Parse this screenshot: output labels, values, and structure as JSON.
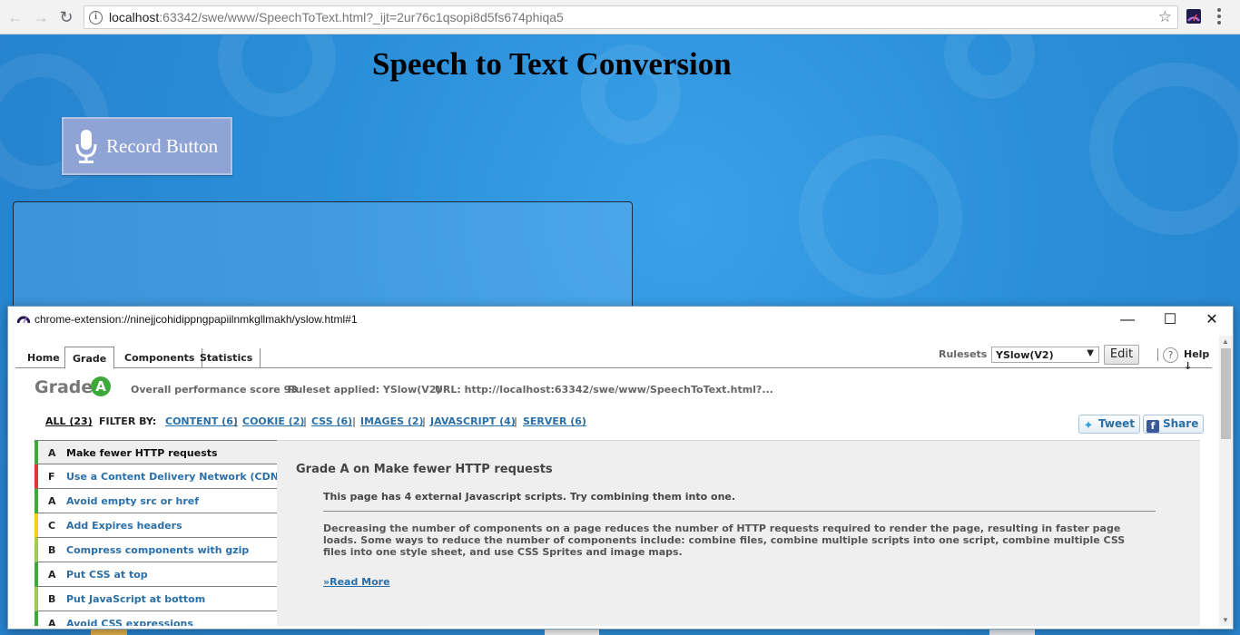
{
  "browser": {
    "url_host": "localhost",
    "url_rest": ":63342/swe/www/SpeechToText.html?_ijt=2ur76c1qsopi8d5fs674phiqa5"
  },
  "page": {
    "title": "Speech to Text Conversion",
    "record_button_label": "Record Button"
  },
  "popup": {
    "window_title": "chrome-extension://ninejjcohidippngpapiilnmkgllmakh/yslow.html#1",
    "controls": {
      "minimize": "—",
      "maximize": "☐",
      "close": "✕"
    }
  },
  "yslow": {
    "tabs": [
      {
        "label": "Home",
        "active": false
      },
      {
        "label": "Grade",
        "active": true
      },
      {
        "label": "Components",
        "active": false
      },
      {
        "label": "Statistics",
        "active": false
      }
    ],
    "rulesets_label": "Rulesets",
    "ruleset_selected": "YSlow(V2)",
    "edit_label": "Edit",
    "help_icon": "?",
    "help_label": "Help ↓",
    "grade_word": "Grade",
    "grade_letter": "A",
    "overall_score": "Overall performance score 93",
    "ruleset_applied": "Ruleset applied: YSlow(V2)",
    "url_info": "URL: http://localhost:63342/swe/www/SpeechToText.html?...",
    "filter": {
      "all": "ALL (23)",
      "label": "FILTER BY:",
      "items": [
        "CONTENT (6)",
        "COOKIE (2)",
        "CSS (6)",
        "IMAGES (2)",
        "JAVASCRIPT (4)",
        "SERVER (6)"
      ]
    },
    "tweet_label": "Tweet",
    "share_label": "Share",
    "rules": [
      {
        "grade": "A",
        "name": "Make fewer HTTP requests",
        "color": "#3da93a",
        "active": true
      },
      {
        "grade": "F",
        "name": "Use a Content Delivery Network (CDN)",
        "color": "#d9393a",
        "active": false
      },
      {
        "grade": "A",
        "name": "Avoid empty src or href",
        "color": "#3da93a",
        "active": false
      },
      {
        "grade": "C",
        "name": "Add Expires headers",
        "color": "#f1d21a",
        "active": false
      },
      {
        "grade": "B",
        "name": "Compress components with gzip",
        "color": "#9fcb52",
        "active": false
      },
      {
        "grade": "A",
        "name": "Put CSS at top",
        "color": "#3da93a",
        "active": false
      },
      {
        "grade": "B",
        "name": "Put JavaScript at bottom",
        "color": "#9fcb52",
        "active": false
      },
      {
        "grade": "A",
        "name": "Avoid CSS expressions",
        "color": "#3da93a",
        "active": false
      }
    ],
    "detail": {
      "title": "Grade A on Make fewer HTTP requests",
      "message": "This page has 4 external Javascript scripts. Try combining them into one.",
      "description": "Decreasing the number of components on a page reduces the number of HTTP requests required to render the page, resulting in faster page loads. Some ways to reduce the number of components include: combine files, combine multiple scripts into one script, combine multiple CSS files into one style sheet, and use CSS Sprites and image maps.",
      "read_more": "»Read More"
    }
  }
}
